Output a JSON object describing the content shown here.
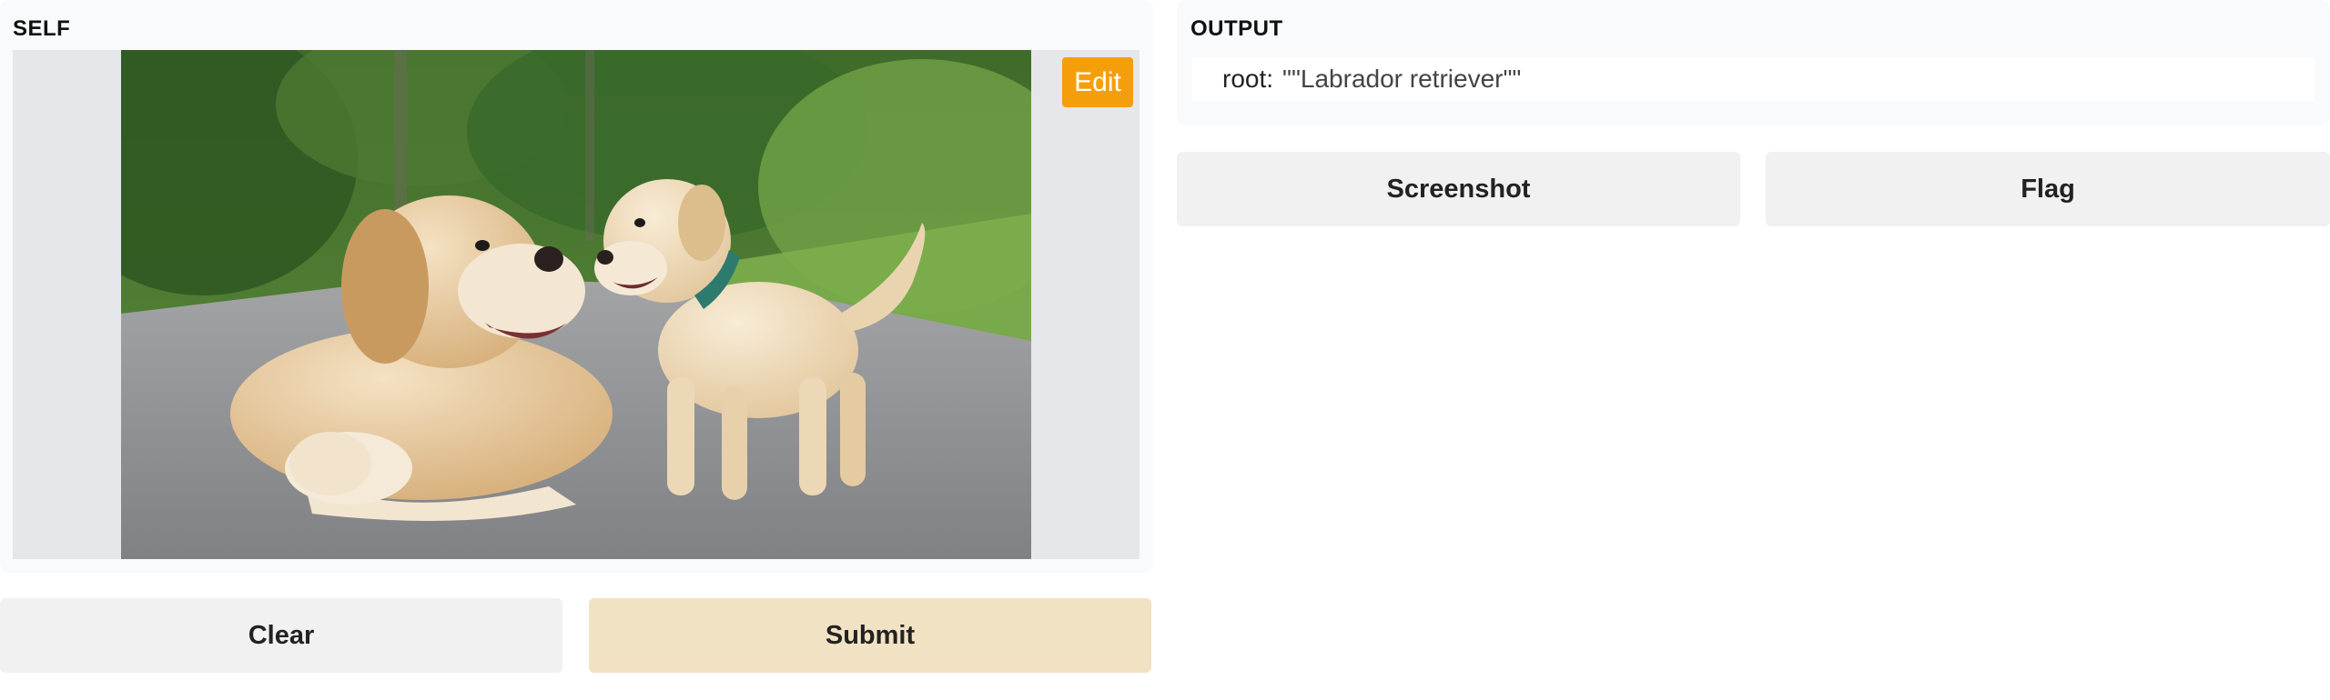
{
  "input": {
    "label": "SELF",
    "edit_label": "Edit",
    "image": {
      "subject": "adult-dog-and-puppy-photo"
    }
  },
  "actions": {
    "clear_label": "Clear",
    "submit_label": "Submit"
  },
  "output": {
    "label": "OUTPUT",
    "key": "root:",
    "value": "\"\"Labrador retriever\"\""
  },
  "output_actions": {
    "screenshot_label": "Screenshot",
    "flag_label": "Flag"
  },
  "colors": {
    "accent": "#f59e0b",
    "submit_bg": "#f2e2c4",
    "button_bg": "#f1f1f1",
    "panel_bg": "#f9fafb"
  }
}
